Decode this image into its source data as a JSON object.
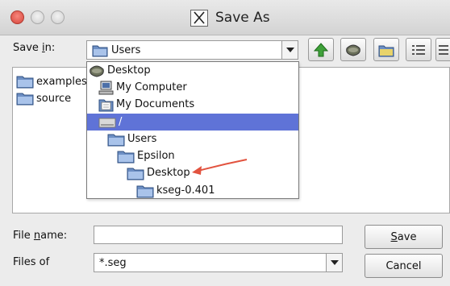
{
  "window": {
    "title": "Save As"
  },
  "save_in": {
    "label_pre": "Save ",
    "label_mnemonic": "i",
    "label_post": "n:",
    "selected": "Users"
  },
  "files": [
    {
      "name": "examples"
    },
    {
      "name": "source"
    }
  ],
  "dropdown": {
    "items": [
      {
        "label": "Desktop",
        "icon": "desktop-icon",
        "indent": 0
      },
      {
        "label": "My Computer",
        "icon": "computer-icon",
        "indent": 1
      },
      {
        "label": "My Documents",
        "icon": "documents-icon",
        "indent": 1
      },
      {
        "label": "/",
        "icon": "drive-icon",
        "indent": 1,
        "selected": true
      },
      {
        "label": "Users",
        "icon": "folder-icon",
        "indent": 2
      },
      {
        "label": "Epsilon",
        "icon": "folder-icon",
        "indent": 3
      },
      {
        "label": "Desktop",
        "icon": "folder-icon",
        "indent": 4
      },
      {
        "label": "kseg-0.401",
        "icon": "folder-icon",
        "indent": 5
      }
    ]
  },
  "file_name": {
    "label_pre": "File ",
    "label_mnemonic": "n",
    "label_post": "ame:",
    "value": ""
  },
  "files_of": {
    "label": "Files of",
    "selected": "*.seg"
  },
  "buttons": {
    "save_mnemonic": "S",
    "save_rest": "ave",
    "cancel": "Cancel"
  },
  "colors": {
    "selection": "#5f73d7",
    "annotation_arrow": "#e2533f"
  }
}
